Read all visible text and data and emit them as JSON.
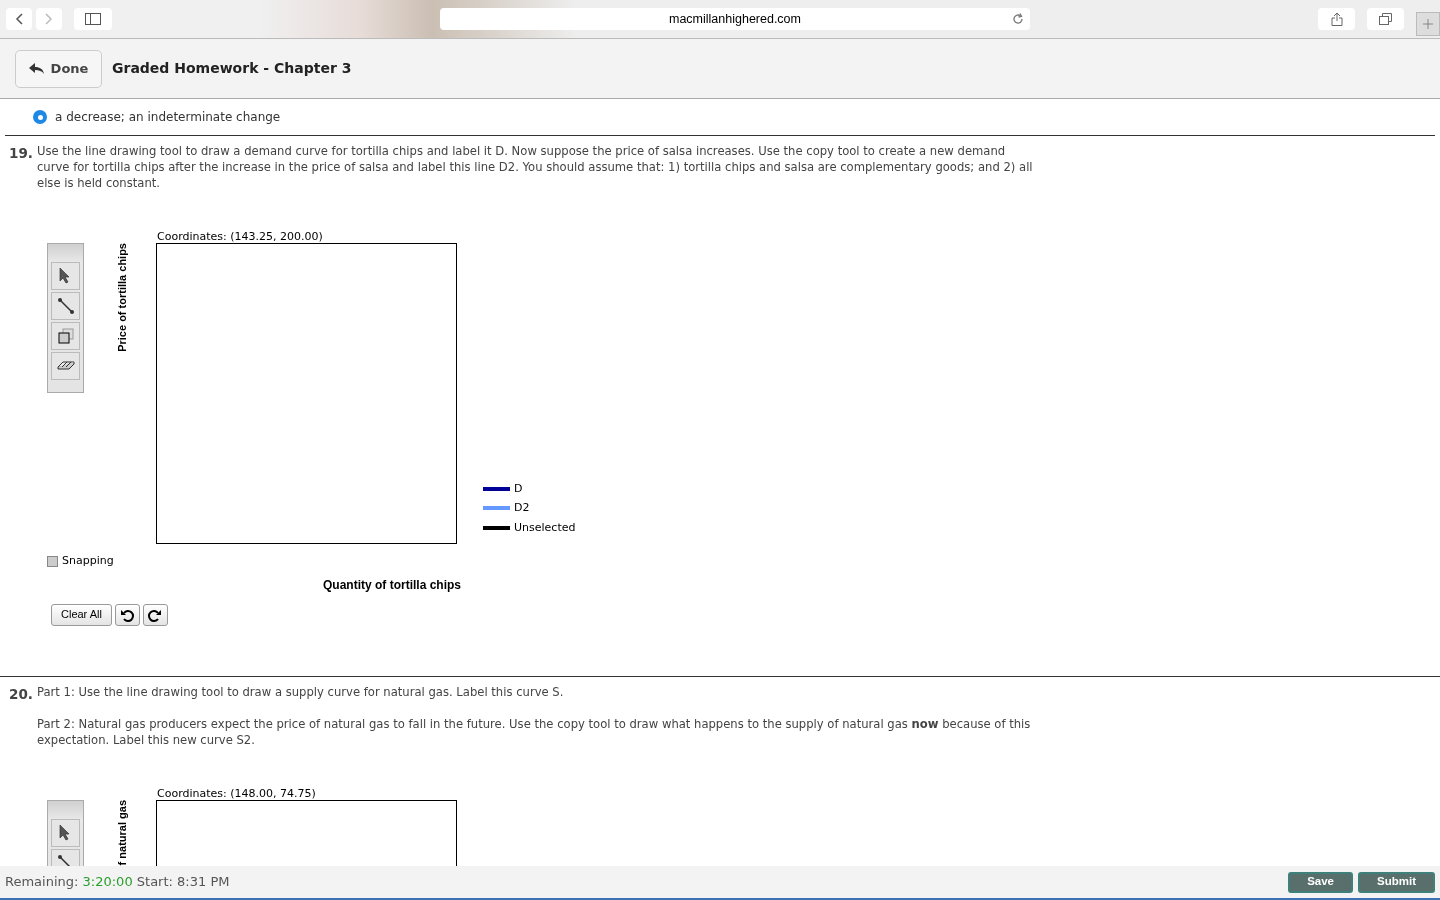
{
  "browser": {
    "url": "macmillanhighered.com"
  },
  "header": {
    "back_button": "Done",
    "title": "Graded Homework - Chapter 3"
  },
  "prev_answer": {
    "text": "a decrease; an indeterminate change",
    "selected": true
  },
  "questions": [
    {
      "number": "19.",
      "paragraphs": [
        "Use the line drawing tool to draw a demand curve for tortilla chips and label it D. Now suppose the price of salsa increases. Use the copy tool to create a new demand curve for tortilla chips after the increase in the price of salsa and label this line D2. You should assume that: 1) tortilla chips and salsa are complementary goods; and 2) all else is held constant."
      ],
      "graph": {
        "coordinates": "Coordinates: (143.25, 200.00)",
        "y_label": "Price of tortilla chips",
        "x_label": "Quantity of tortilla chips",
        "tools": [
          {
            "kind": "pointer"
          },
          {
            "kind": "line"
          },
          {
            "kind": "copy"
          },
          {
            "kind": "eraser"
          }
        ],
        "legend": [
          {
            "label": "D",
            "color": "#000099"
          },
          {
            "label": "D2",
            "color": "#6699ff"
          },
          {
            "label": "Unselected",
            "color": "#000000"
          }
        ],
        "snapping": {
          "label": "Snapping",
          "checked": false
        },
        "clear_button": "Clear All"
      }
    },
    {
      "number": "20.",
      "paragraphs": [
        "Part 1: Use the line drawing tool to draw a supply curve for natural gas. Label this curve S.",
        "Part 2: Natural gas producers expect the price of natural gas to fall in the future. Use the copy tool to draw what happens to the supply of natural gas **now** because of this expectation. Label this new curve S2."
      ],
      "graph": {
        "coordinates": "Coordinates: (148.00, 74.75)",
        "y_label": "f natural gas",
        "tools": [
          {
            "kind": "pointer"
          },
          {
            "kind": "line"
          }
        ]
      }
    }
  ],
  "footer": {
    "remaining_label": "Remaining:",
    "remaining": "3:20:00",
    "start": "Start: 8:31 PM",
    "buttons": [
      "Save",
      "Submit"
    ]
  }
}
